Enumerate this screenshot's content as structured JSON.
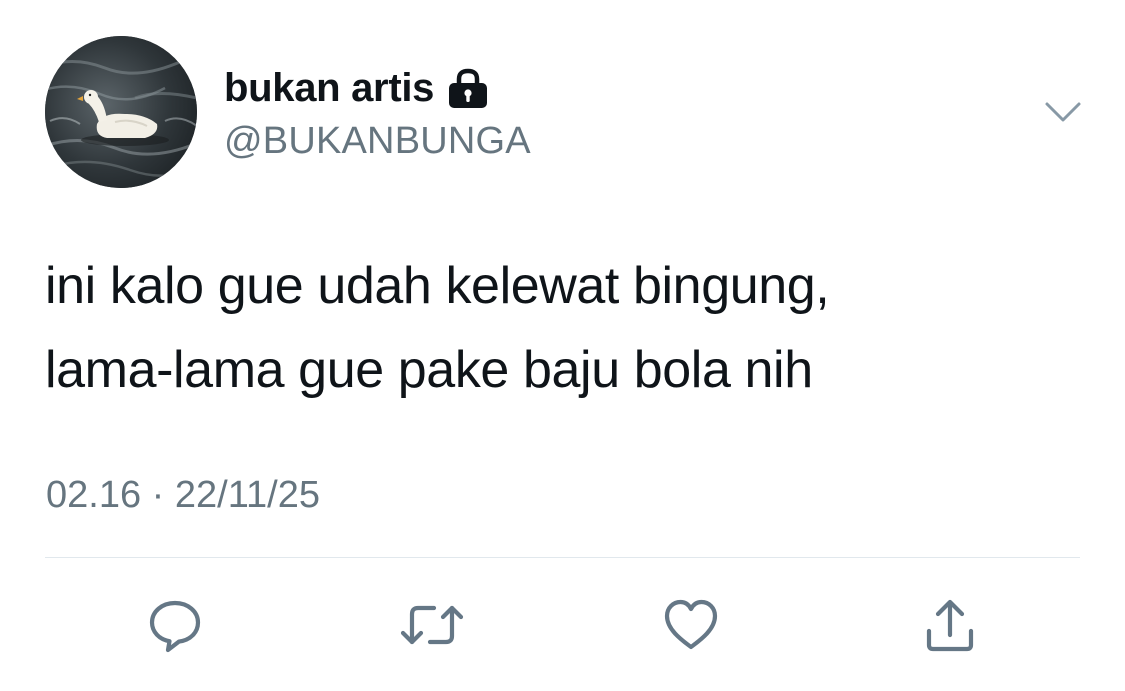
{
  "user": {
    "display_name": "bukan artis",
    "handle": "@BUKANBUNGA",
    "protected_icon": "lock-icon",
    "avatar": "duck-on-water-avatar"
  },
  "menu": {
    "icon": "chevron-down-icon"
  },
  "tweet": {
    "lines": [
      "ini kalo gue udah kelewat bingung,",
      "lama-lama gue pake baju bola nih"
    ],
    "time": "02.16",
    "separator": "·",
    "date": "22/11/25"
  },
  "actions": [
    {
      "name": "reply",
      "icon": "reply-icon"
    },
    {
      "name": "retweet",
      "icon": "retweet-icon"
    },
    {
      "name": "like",
      "icon": "heart-icon"
    },
    {
      "name": "share",
      "icon": "share-icon"
    }
  ],
  "colors": {
    "text_primary": "#0f1419",
    "text_secondary": "#66757f",
    "icon_gray": "#657786",
    "divider": "#e1e8ed",
    "background": "#ffffff"
  }
}
